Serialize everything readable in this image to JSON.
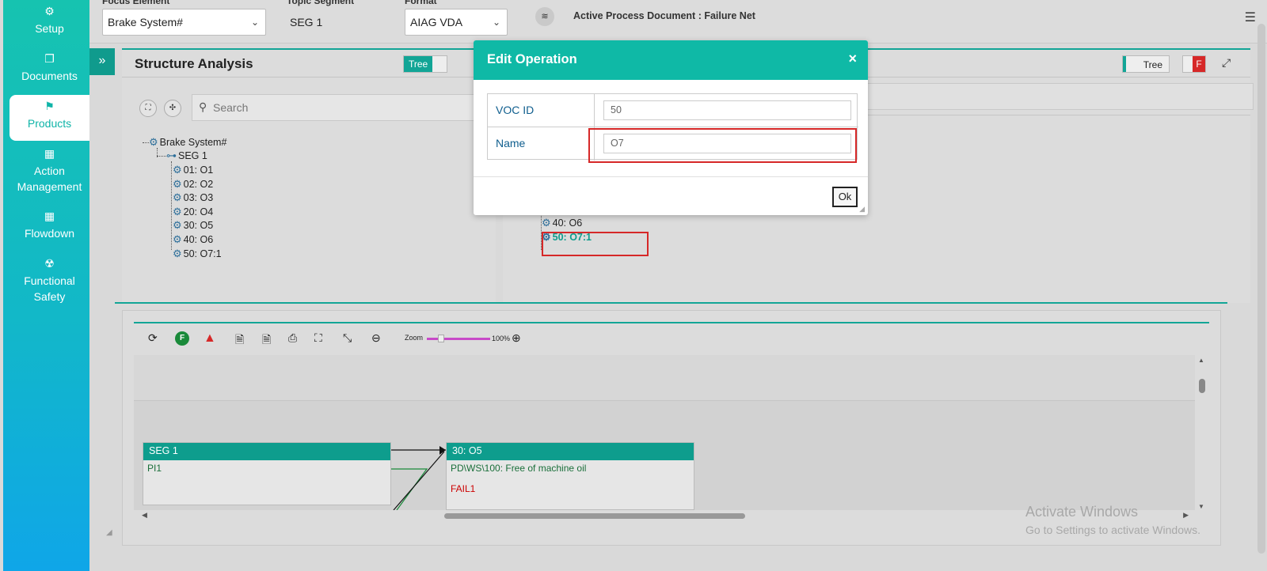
{
  "sidebar": {
    "items": [
      {
        "label": "Setup",
        "icon": "gear-icon",
        "glyph": "⚙"
      },
      {
        "label": "Documents",
        "icon": "documents-icon",
        "glyph": "❐"
      },
      {
        "label": "Products",
        "icon": "products-icon",
        "glyph": "⚑"
      },
      {
        "label": "Action Management",
        "icon": "building-icon",
        "glyph": "▦"
      },
      {
        "label": "Flowdown",
        "icon": "building-icon",
        "glyph": "▦"
      },
      {
        "label": "Functional Safety",
        "icon": "hazard-icon",
        "glyph": "☢"
      }
    ]
  },
  "topbar": {
    "focus_label": "Focus Element",
    "focus_value": "Brake System#",
    "topic_label": "Topic Segment",
    "topic_value": "SEG 1",
    "format_label": "Format",
    "format_value": "AIAG VDA",
    "active_doc": "Active Process Document : Failure Net"
  },
  "structure": {
    "title": "Structure Analysis",
    "toggle_label": "Tree",
    "search_placeholder": "Search",
    "root": "Brake System#",
    "segment": "SEG 1",
    "ops": [
      "01: O1",
      "02: O2",
      "03: O3",
      "20: O4",
      "30: O5",
      "40: O6",
      "50: O7:1"
    ]
  },
  "right_panel": {
    "toggle_label": "Tree",
    "f_label": "F",
    "ops_visible": [
      "40: O6",
      "50: O7:1"
    ]
  },
  "toolbar": {
    "zoom_label": "Zoom",
    "zoom_value": "100%",
    "f_green": "F",
    "f_red": "F"
  },
  "diagram": {
    "node_a": {
      "title": "SEG 1",
      "line": "PI1"
    },
    "node_b": {
      "title": "30: O5",
      "line": "PD\\WS\\100: Free of machine oil",
      "fail": "FAIL1"
    }
  },
  "watermark": {
    "line1": "Activate Windows",
    "line2": "Go to Settings to activate Windows."
  },
  "modal": {
    "title": "Edit Operation",
    "close": "×",
    "voc_label": "VOC ID",
    "voc_value": "50",
    "name_label": "Name",
    "name_value": "O7",
    "ok_label": "Ok"
  },
  "colors": {
    "accent": "#0fb9a6",
    "accent_dark": "#0e9d8d",
    "highlight": "#d62828"
  }
}
